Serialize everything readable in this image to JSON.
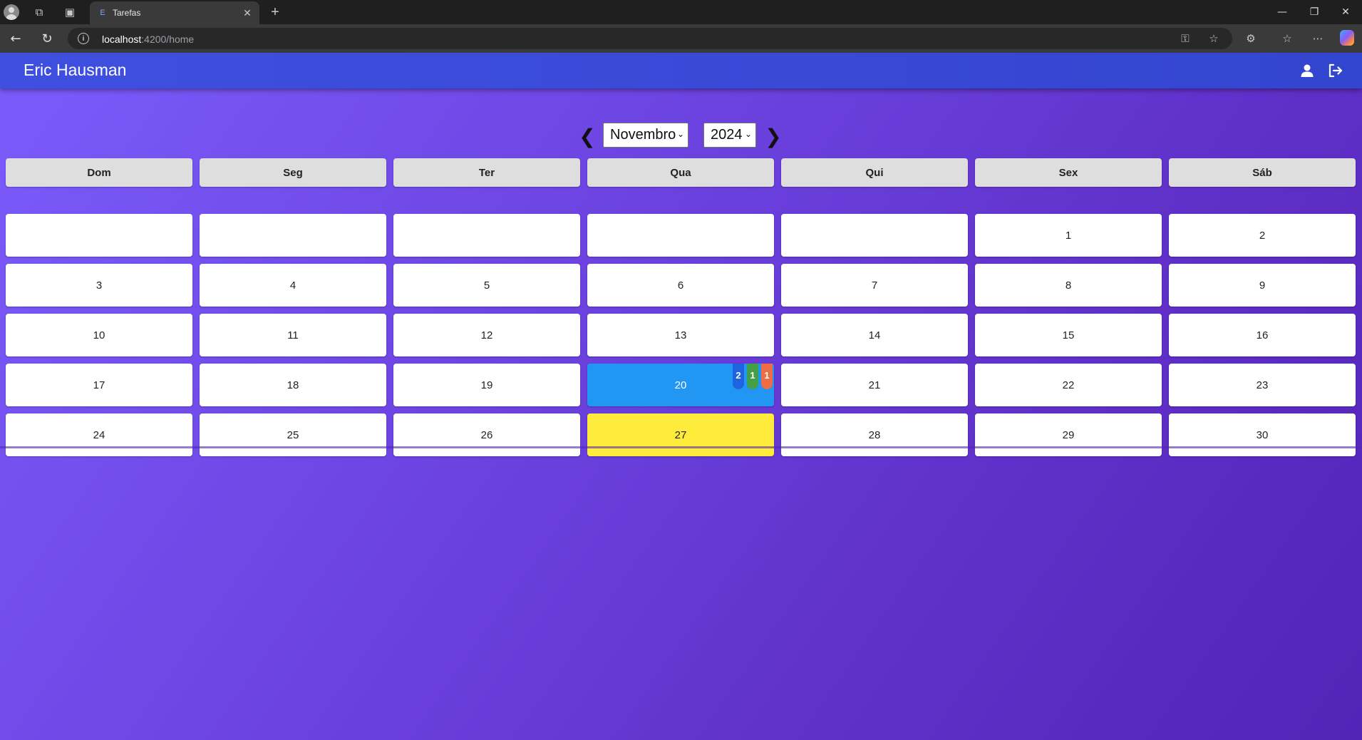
{
  "browser": {
    "tab_title": "Tarefas",
    "tab_favicon": "E",
    "url_host": "localhost",
    "url_rest": ":4200/home"
  },
  "header": {
    "user_name": "Eric Hausman"
  },
  "month_nav": {
    "month": "Novembro",
    "year": "2024"
  },
  "weekdays": [
    "Dom",
    "Seg",
    "Ter",
    "Qua",
    "Qui",
    "Sex",
    "Sáb"
  ],
  "days": [
    "",
    "",
    "",
    "",
    "",
    "1",
    "2",
    "3",
    "4",
    "5",
    "6",
    "7",
    "8",
    "9",
    "10",
    "11",
    "12",
    "13",
    "14",
    "15",
    "16",
    "17",
    "18",
    "19",
    "20",
    "21",
    "22",
    "23",
    "24",
    "25",
    "26",
    "27",
    "28",
    "29",
    "30"
  ],
  "selected_day": "20",
  "today_day": "27",
  "badges": [
    {
      "count": "2",
      "color": "#1e63e0"
    },
    {
      "count": "1",
      "color": "#43a047"
    },
    {
      "count": "1",
      "color": "#ef6c45"
    }
  ],
  "colors": {
    "header": "#3f4fe0",
    "selected": "#2196f3",
    "today": "#ffeb3b"
  }
}
